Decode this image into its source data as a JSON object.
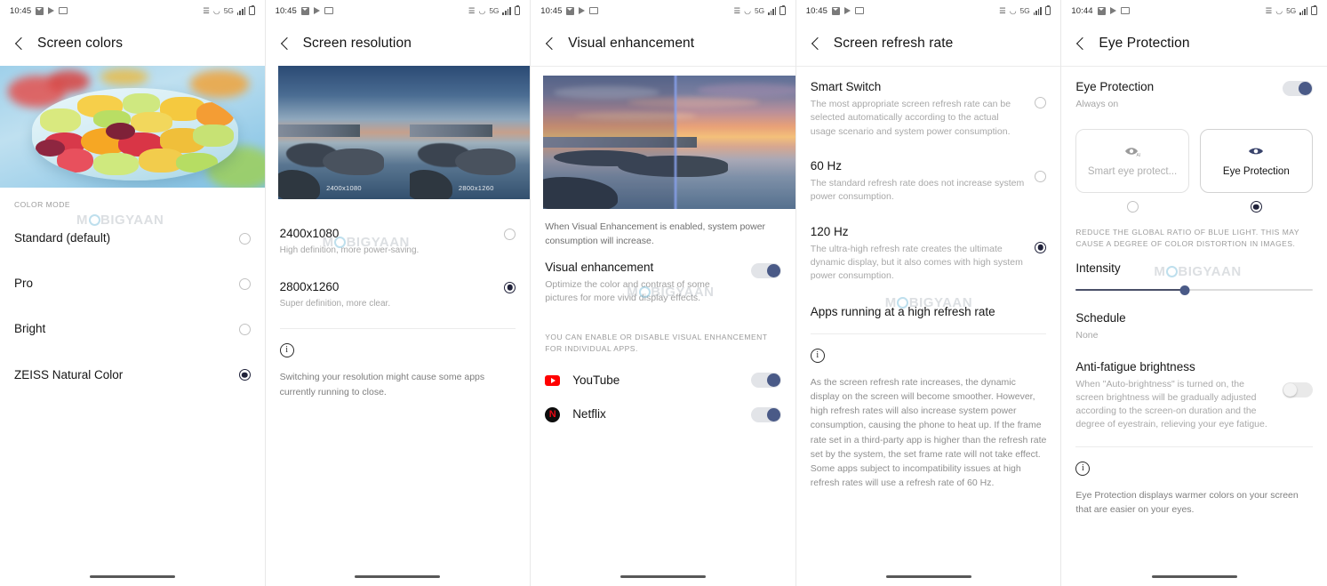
{
  "panels": [
    {
      "status": {
        "time": "10:45",
        "network": "5G"
      },
      "title": "Screen colors",
      "section_header": "COLOR MODE",
      "options": [
        {
          "label": "Standard (default)",
          "selected": false
        },
        {
          "label": "Pro",
          "selected": false
        },
        {
          "label": "Bright",
          "selected": false
        },
        {
          "label": "ZEISS Natural Color",
          "selected": true
        }
      ],
      "watermark": "MOBIGYAAN"
    },
    {
      "status": {
        "time": "10:45",
        "network": "5G"
      },
      "title": "Screen resolution",
      "image_labels": [
        "2400x1080",
        "2800x1260"
      ],
      "options": [
        {
          "label": "2400x1080",
          "sub": "High definition, more power-saving.",
          "selected": false
        },
        {
          "label": "2800x1260",
          "sub": "Super definition, more clear.",
          "selected": true
        }
      ],
      "info": "Switching your resolution might cause some apps currently running to close.",
      "watermark": "MOBIGYAAN"
    },
    {
      "status": {
        "time": "10:45",
        "network": "5G"
      },
      "title": "Visual enhancement",
      "caption": "When Visual Enhancement is enabled, system power consumption will increase.",
      "main_toggle": {
        "label": "Visual enhancement",
        "sub": "Optimize the color and contrast of some pictures for more vivid display effects.",
        "on": true
      },
      "section_header": "YOU CAN ENABLE OR DISABLE VISUAL ENHANCEMENT FOR INDIVIDUAL APPS.",
      "apps": [
        {
          "name": "YouTube",
          "icon": "youtube-icon",
          "on": true
        },
        {
          "name": "Netflix",
          "icon": "netflix-icon",
          "on": true
        }
      ],
      "watermark": "MOBIGYAAN"
    },
    {
      "status": {
        "time": "10:45",
        "network": "5G"
      },
      "title": "Screen refresh rate",
      "options": [
        {
          "label": "Smart Switch",
          "sub": "The most appropriate screen refresh rate can be selected automatically according to the actual usage scenario and system power consumption.",
          "selected": false
        },
        {
          "label": "60 Hz",
          "sub": "The standard refresh rate does not increase system power consumption.",
          "selected": false
        },
        {
          "label": "120 Hz",
          "sub": "The ultra-high refresh rate creates the ultimate dynamic display, but it also comes with high system power consumption.",
          "selected": true
        }
      ],
      "apps_row": "Apps running at a high refresh rate",
      "info": "As the screen refresh rate increases, the dynamic display on the screen will become smoother. However, high refresh rates will also increase system power consumption, causing the phone to heat up. If the frame rate set in a third-party app is higher than the refresh rate set by the system, the set frame rate will not take effect. Some apps subject to incompatibility issues at high refresh rates will use a refresh rate of 60 Hz.",
      "watermark": "MOBIGYAAN"
    },
    {
      "status": {
        "time": "10:44",
        "network": "5G"
      },
      "title": "Eye Protection",
      "main_toggle": {
        "label": "Eye Protection",
        "sub": "Always on",
        "on": true
      },
      "cards": [
        {
          "label": "Smart eye protect...",
          "icon": "eye-ai-icon",
          "selected": false
        },
        {
          "label": "Eye Protection",
          "icon": "eye-icon",
          "selected": true
        }
      ],
      "section_header": "REDUCE THE GLOBAL RATIO OF BLUE LIGHT. THIS MAY CAUSE A DEGREE OF COLOR DISTORTION IN IMAGES.",
      "intensity": {
        "label": "Intensity",
        "value_percent": 46
      },
      "schedule": {
        "label": "Schedule",
        "value": "None"
      },
      "anti_fatigue": {
        "label": "Anti-fatigue brightness",
        "sub": "When \"Auto-brightness\" is turned on, the screen brightness will be gradually adjusted according to the screen-on duration and the degree of eyestrain, relieving your eye fatigue.",
        "on": false
      },
      "info": "Eye Protection displays warmer colors on your screen that are easier on your eyes.",
      "watermark": "MOBIGYAAN"
    }
  ],
  "colors": {
    "accent": "#4a5a87",
    "radio_selected": "#20223a",
    "text_primary": "#161616",
    "text_secondary": "#a6a6a6"
  }
}
